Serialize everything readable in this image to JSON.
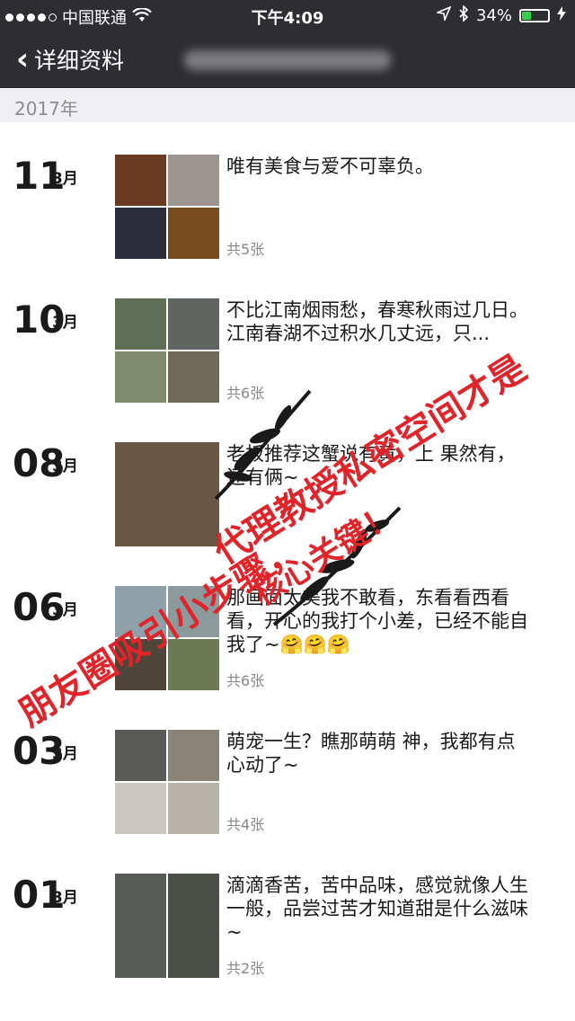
{
  "status": {
    "carrier": "中国联通",
    "time": "下午4:09",
    "battery": "34%",
    "battery_level": 0.34
  },
  "nav": {
    "back_label": "详细资料"
  },
  "year": "2017年",
  "posts": [
    {
      "day": "11",
      "month": "3月",
      "text": "唯有美食与爱不可辜负。",
      "count": "共5张",
      "thumbs": [
        "#6b3a22",
        "#9b9690",
        "#2b2c3a",
        "#7a4b1e"
      ]
    },
    {
      "day": "10",
      "month": "3月",
      "text": "不比江南烟雨愁，春寒秋雨过几日。江南春湖不过积水几丈远，只...",
      "count": "共6张",
      "thumbs": [
        "#5f6e54",
        "#616561",
        "#7f8a6a",
        "#6f6a58"
      ]
    },
    {
      "day": "08",
      "month": "3月",
      "text": "老板推荐这蟹说有黄，上    果然有，还有俩~",
      "count": "",
      "thumbs": [
        "#6a5642"
      ]
    },
    {
      "day": "06",
      "month": "3月",
      "text": "那画面太美我不敢看，东看看西看看，开心的我打个小差，已经不能自我了~🤗🤗🤗",
      "count": "共6张",
      "thumbs": [
        "#8ea0a8",
        "#8b9a9c",
        "#4d4639",
        "#6b7a55"
      ]
    },
    {
      "day": "03",
      "month": "3月",
      "text": "萌宠一生？瞧那萌萌    神，我都有点心动了~",
      "count": "共4张",
      "thumbs": [
        "#5a5a58",
        "#8a8478",
        "#c9c7c1",
        "#b7b3a8"
      ]
    },
    {
      "day": "01",
      "month": "3月",
      "text": "滴滴香苦，苦中品味，感觉就像人生一般，品尝过苦才知道甜是什么滋味~",
      "count": "共2张",
      "thumbs": [
        "#585a58",
        "#4a5048"
      ]
    }
  ],
  "watermark": {
    "line1": "代理教授私密空间才是",
    "line2": "朋友圈吸引小步骤，",
    "line3": "核心关键！"
  }
}
